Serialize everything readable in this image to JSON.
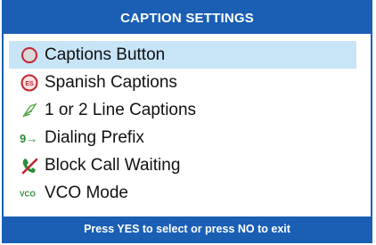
{
  "window": {
    "title": "CAPTION SETTINGS",
    "footer_hint": "Press YES to select or press NO to exit"
  },
  "menu": {
    "selected_index": 0,
    "items": [
      {
        "label": "Captions Button",
        "icon": "circle-button-icon"
      },
      {
        "label": "Spanish Captions",
        "icon": "es-badge-icon",
        "badge_text": "ES"
      },
      {
        "label": "1 or 2 Line Captions",
        "icon": "caption-lines-icon"
      },
      {
        "label": "Dialing Prefix",
        "icon": "dialing-prefix-icon",
        "badge_text": "9→"
      },
      {
        "label": "Block Call Waiting",
        "icon": "block-call-waiting-icon"
      },
      {
        "label": "VCO Mode",
        "icon": "vco-icon",
        "badge_text": "VCO"
      }
    ]
  },
  "colors": {
    "primary": "#1a5fb4",
    "selection": "#c8e4f7",
    "accent_red": "#c0262d",
    "accent_green": "#2e8b3a"
  }
}
